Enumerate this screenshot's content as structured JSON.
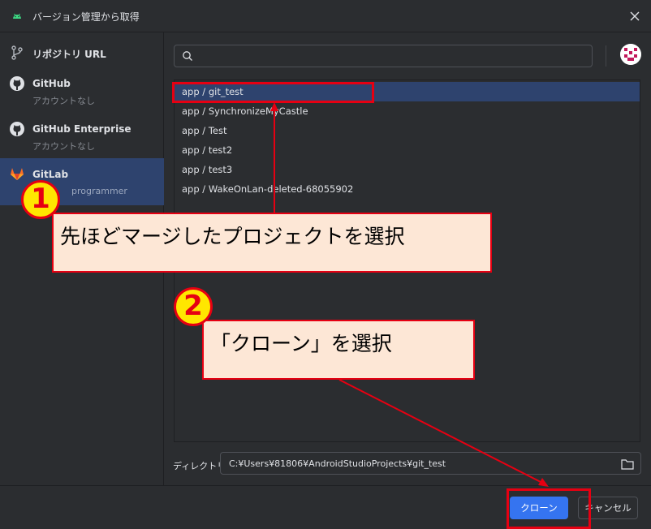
{
  "window": {
    "title": "バージョン管理から取得"
  },
  "sidebar": {
    "items": [
      {
        "name": "リポジトリ URL",
        "sub": ""
      },
      {
        "name": "GitHub",
        "sub": "アカウントなし"
      },
      {
        "name": "GitHub Enterprise",
        "sub": "アカウントなし"
      },
      {
        "name": "GitLab",
        "sub": "programmer"
      }
    ]
  },
  "search": {
    "value": ""
  },
  "repos": [
    "app / git_test",
    "app / SynchronizeMyCastle",
    "app / Test",
    "app / test2",
    "app / test3",
    "app / WakeOnLan-deleted-68055902"
  ],
  "directory": {
    "label": "ディレクトリ:",
    "value": "C:¥Users¥81806¥AndroidStudioProjects¥git_test"
  },
  "buttons": {
    "clone": "クローン",
    "cancel": "キャンセル"
  },
  "annotations": {
    "step1_number": "1",
    "step1_text": "先ほどマージしたプロジェクトを選択",
    "step2_number": "2",
    "step2_text": "「クローン」を選択"
  },
  "colors": {
    "accent": "#3574f0",
    "selection": "#2e436e",
    "annotation_red": "#e60012",
    "annotation_yellow": "#ffe600",
    "callout_bg": "#fde7d6"
  }
}
